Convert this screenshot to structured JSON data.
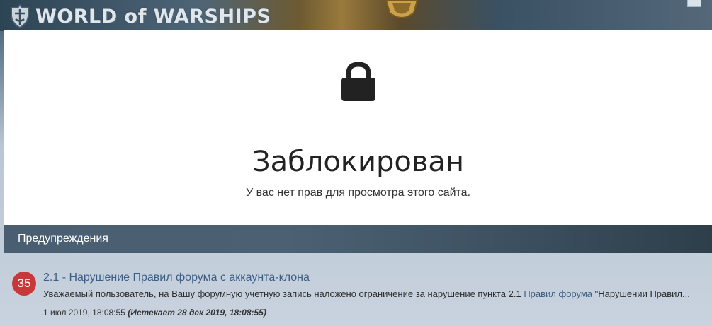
{
  "header": {
    "logo_text": "WORLD of WARSHIPS",
    "logo_icon": "warships-emblem-icon",
    "colors": {
      "logo_text": "#dfe6ec"
    }
  },
  "blocked": {
    "icon": "lock-icon",
    "title": "Заблокирован",
    "message": "У вас нет прав для просмотра этого сайта."
  },
  "warnings": {
    "header": "Предупреждения",
    "items": [
      {
        "points": "35",
        "title": "2.1 - Нарушение Правил форума с аккаунта-клона",
        "desc_before": "Уважаемый пользователь, на Вашу форумную учетную запись наложено ограничение за нарушение пункта 2.1",
        "link_text": "Правил форума",
        "desc_after": "\"Нарушении Правил...",
        "date": "1 июл 2019, 18:08:55",
        "expires": "(Истекает 28 дек 2019, 18:08:55)"
      }
    ]
  },
  "colors": {
    "badge": "#c8383a",
    "link": "#3d5f85",
    "warn_header_bg": "#495f71"
  }
}
